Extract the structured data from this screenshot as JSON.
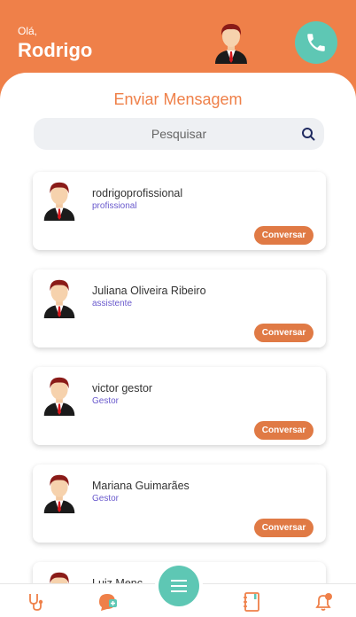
{
  "header": {
    "greeting": "Olá,",
    "user_name": "Rodrigo"
  },
  "main": {
    "title": "Enviar Mensagem",
    "search": {
      "placeholder": "Pesquisar",
      "value": ""
    },
    "contacts": [
      {
        "name": "rodrigoprofissional",
        "role": "profissional",
        "action": "Conversar"
      },
      {
        "name": "Juliana Oliveira Ribeiro",
        "role": "assistente",
        "action": "Conversar"
      },
      {
        "name": "victor gestor",
        "role": "Gestor",
        "action": "Conversar"
      },
      {
        "name": "Mariana Guimarães",
        "role": "Gestor",
        "action": "Conversar"
      },
      {
        "name": "Luiz Menc",
        "role": "",
        "action": ""
      }
    ]
  },
  "colors": {
    "brand_orange": "#ef8049",
    "teal": "#5ec7b4",
    "role_text": "#6a5acd"
  },
  "icons": {
    "call": "phone-icon",
    "search": "search-icon",
    "menu": "menu-icon",
    "nav": [
      "stethoscope-icon",
      "chat-plus-icon",
      "contacts-book-icon",
      "bell-icon"
    ]
  }
}
